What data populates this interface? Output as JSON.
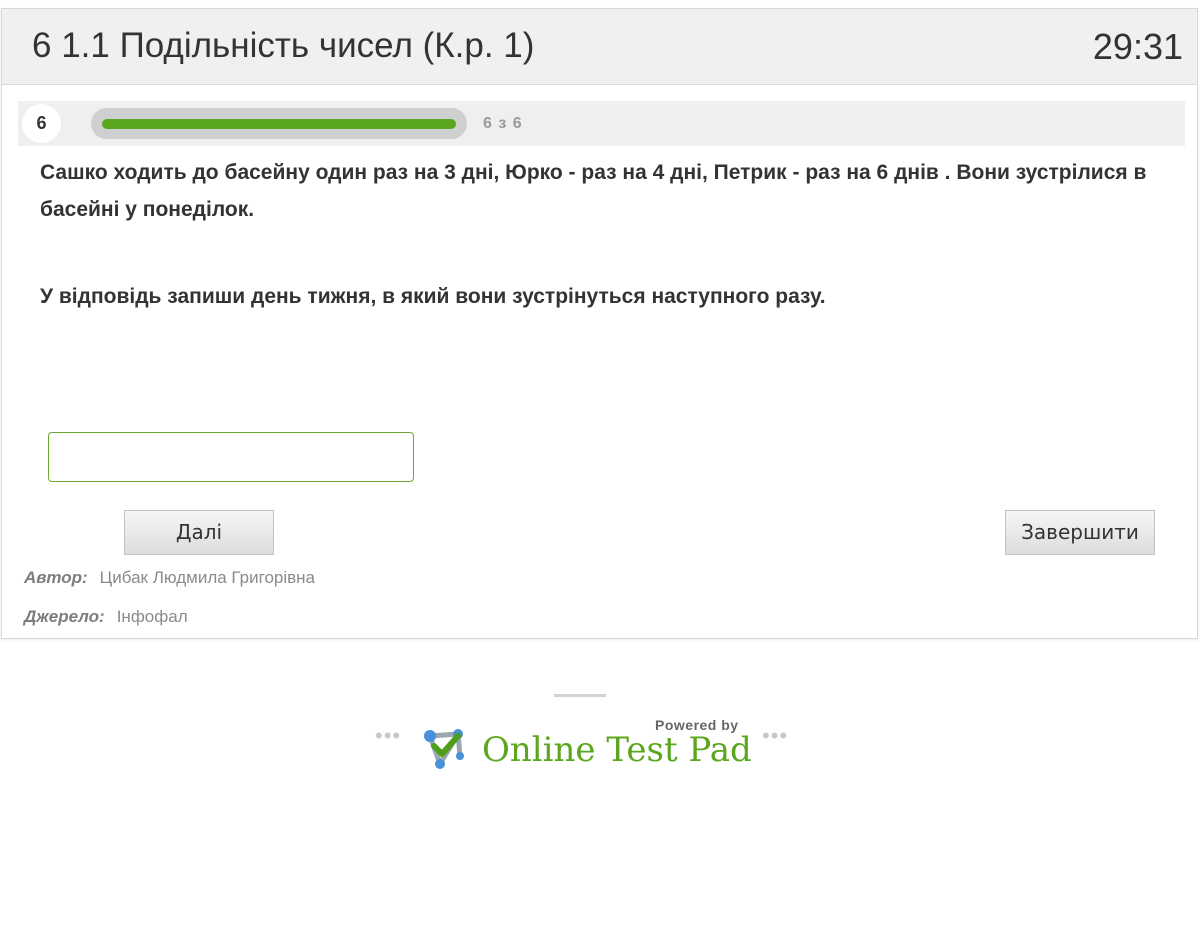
{
  "header": {
    "title": "6 1.1 Подільність чисел (К.р. 1)",
    "timer": "29:31"
  },
  "progress": {
    "question_number": "6",
    "label": "6 з 6",
    "current": 6,
    "total": 6,
    "fill_fraction": 1.0,
    "fill_color": "#5aa61c"
  },
  "question": {
    "paragraph1": "Сашко ходить до басейну один раз на 3 дні, Юрко - раз на 4 дні, Петрик - раз на 6 днів . Вони зустрілися в басейні у понеділок.",
    "paragraph2": "У відповідь запиши  день тижня, в який вони зустрінуться наступного разу."
  },
  "answer": {
    "value": "",
    "border_color": "#6aa631"
  },
  "buttons": {
    "next_label": "Далі",
    "finish_label": "Завершити"
  },
  "meta": {
    "author_label": "Автор:",
    "author_value": "Цибак Людмила Григорівна",
    "source_label": "Джерело:",
    "source_value": "Інфофал"
  },
  "footer": {
    "powered_by": "Powered by",
    "brand": "Online Test Pad",
    "dots": "•••",
    "brand_color": "#5aa61c"
  }
}
